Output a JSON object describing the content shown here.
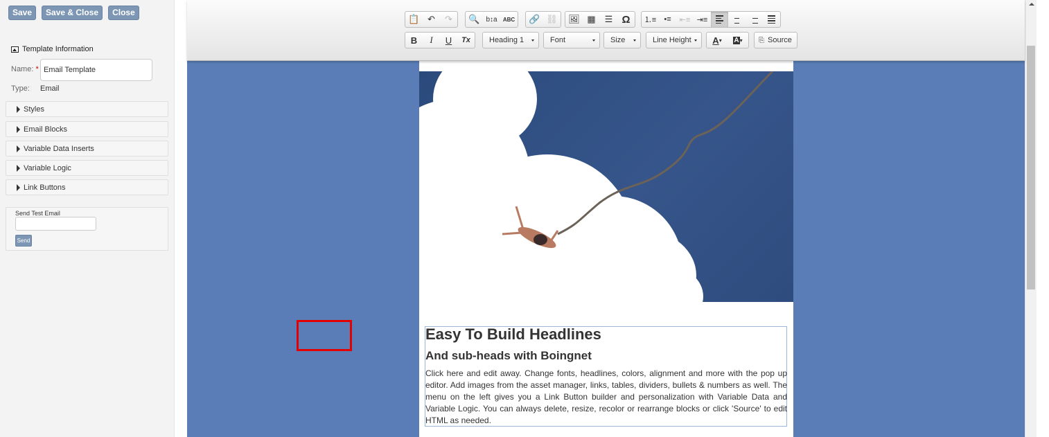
{
  "buttons": {
    "save": "Save",
    "save_close": "Save & Close",
    "close": "Close"
  },
  "template_info": {
    "heading": "Template Information",
    "name_label": "Name:",
    "required_mark": "*",
    "name_value": "Email Template",
    "type_label": "Type:",
    "type_value": "Email"
  },
  "accordion": [
    "Styles",
    "Email Blocks",
    "Variable Data Inserts",
    "Variable Logic",
    "Link Buttons"
  ],
  "send_test": {
    "label": "Send Test Email",
    "input_value": "",
    "button": "Send"
  },
  "toolbar": {
    "heading": "Heading 1",
    "font": "Font",
    "size": "Size",
    "line_height": "Line Height",
    "source": "Source",
    "bold": "B",
    "italic": "I",
    "underline": "U",
    "remove_format": "Tx",
    "special_char": "Ω",
    "text_color": "A",
    "bg_color": "A"
  },
  "content": {
    "headline": "Easy To Build Headlines",
    "subhead": "And sub-heads with Boingnet",
    "body": "Click here and edit away. Change fonts, headlines, colors, alignment and more with the pop up editor. Add images from the asset manager, links, tables, dividers, bullets & numbers as well. The menu on the left gives you a Link Button builder and personalization with Variable Data and Variable Logic. You can always delete, resize, recolor or rearrange blocks or click 'Source' to edit HTML as needed."
  },
  "colors": {
    "canvas": "#5a7db7",
    "button": "#7c96b4",
    "highlight": "#e20000"
  }
}
